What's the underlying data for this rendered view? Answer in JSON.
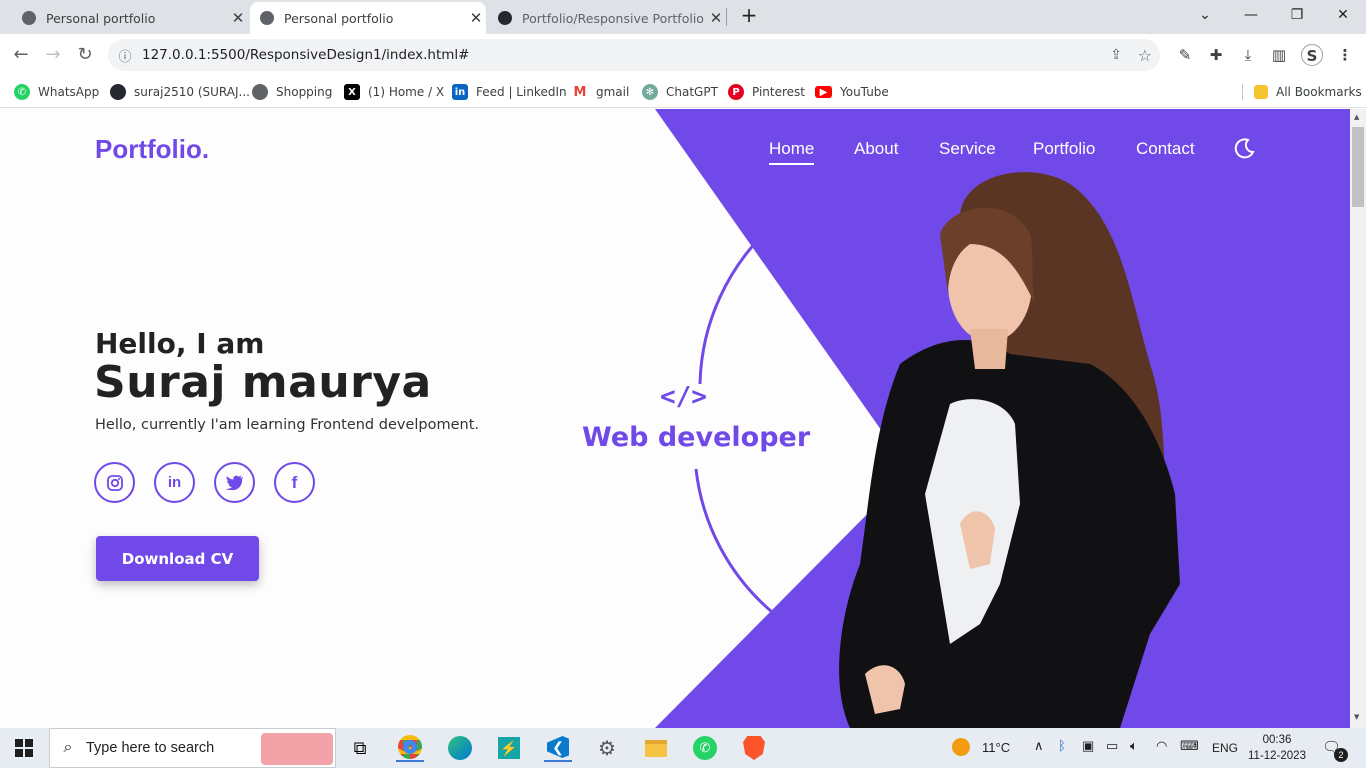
{
  "browser": {
    "tabs": [
      {
        "title": "Personal portfolio",
        "active": false
      },
      {
        "title": "Personal portfolio",
        "active": true
      },
      {
        "title": "Portfolio/Responsive Portfolio at",
        "active": false
      }
    ],
    "url": "127.0.0.1:5500/ResponsiveDesign1/index.html#",
    "profile_initial": "S"
  },
  "bookmarks": [
    {
      "label": "WhatsApp",
      "icon": "whatsapp-icon",
      "color": "#25d366"
    },
    {
      "label": "suraj2510 (SURAJ...",
      "icon": "github-icon",
      "color": "#24292f"
    },
    {
      "label": "Shopping",
      "icon": "globe-icon",
      "color": "#5f6368"
    },
    {
      "label": "(1) Home / X",
      "icon": "x-icon",
      "color": "#000000"
    },
    {
      "label": "Feed | LinkedIn",
      "icon": "linkedin-icon",
      "color": "#0a66c2"
    },
    {
      "label": "gmail",
      "icon": "gmail-icon",
      "color": "#ea4335"
    },
    {
      "label": "ChatGPT",
      "icon": "chatgpt-icon",
      "color": "#74aa9c"
    },
    {
      "label": "Pinterest",
      "icon": "pinterest-icon",
      "color": "#e60023"
    },
    {
      "label": "YouTube",
      "icon": "youtube-icon",
      "color": "#ff0000"
    }
  ],
  "all_bookmarks_label": "All Bookmarks",
  "site": {
    "logo": "Portfolio.",
    "nav": [
      {
        "label": "Home",
        "active": true
      },
      {
        "label": "About",
        "active": false
      },
      {
        "label": "Service",
        "active": false
      },
      {
        "label": "Portfolio",
        "active": false
      },
      {
        "label": "Contact",
        "active": false
      }
    ],
    "hero": {
      "greeting": "Hello, I am",
      "name": "Suraj maurya",
      "tagline": "Hello, currently I'am learning Frontend develpoment.",
      "cta": "Download CV",
      "role_icon": "</>",
      "role": "Web developer"
    },
    "socials": [
      "instagram-icon",
      "linkedin-icon",
      "twitter-icon",
      "facebook-icon"
    ],
    "accent": "#7149e8"
  },
  "taskbar": {
    "search_placeholder": "Type here to search",
    "weather": "11°C",
    "lang": "ENG",
    "time": "00:36",
    "date": "11-12-2023",
    "notifications": "2"
  }
}
